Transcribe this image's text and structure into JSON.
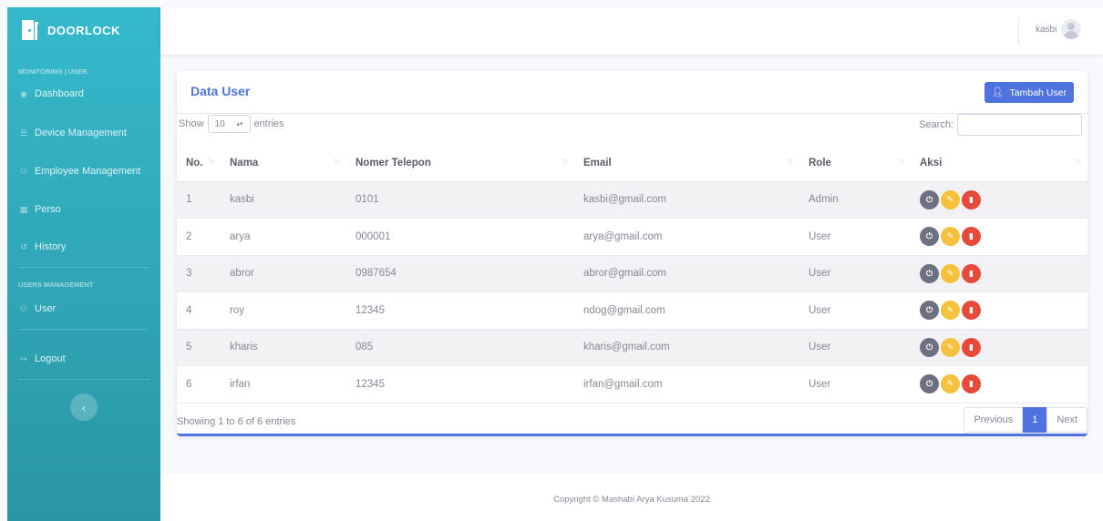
{
  "brand": {
    "name": "DOORLOCK"
  },
  "sidebar": {
    "heading_monitoring": "MONITORING | USER",
    "heading_users": "USERS MANAGEMENT",
    "items": [
      {
        "label": "Dashboard",
        "icon": "dashboard-icon"
      },
      {
        "label": "Device Management",
        "icon": "device-icon"
      },
      {
        "label": "Employee Management",
        "icon": "users-icon"
      },
      {
        "label": "Perso",
        "icon": "building-icon"
      },
      {
        "label": "History",
        "icon": "history-icon"
      },
      {
        "label": "User",
        "icon": "users-icon"
      },
      {
        "label": "Logout",
        "icon": "logout-icon"
      }
    ],
    "toggle": "‹"
  },
  "topbar": {
    "username": "kasbi"
  },
  "card": {
    "title": "Data User",
    "add_button": "Tambah User",
    "show_label": "Show",
    "entries_label": "entries",
    "page_size": "10",
    "search_label": "Search:",
    "search_value": ""
  },
  "table": {
    "columns": [
      "No.",
      "Nama",
      "Nomer Telepon",
      "Email",
      "Role",
      "Aksi"
    ],
    "rows": [
      {
        "no": "1",
        "nama": "kasbi",
        "telepon": "0101",
        "email": "kasbi@gmail.com",
        "role": "Admin"
      },
      {
        "no": "2",
        "nama": "arya",
        "telepon": "000001",
        "email": "arya@gmail.com",
        "role": "User"
      },
      {
        "no": "3",
        "nama": "abror",
        "telepon": "0987654",
        "email": "abror@gmail.com",
        "role": "User"
      },
      {
        "no": "4",
        "nama": "roy",
        "telepon": "12345",
        "email": "ndog@gmail.com",
        "role": "User"
      },
      {
        "no": "5",
        "nama": "kharis",
        "telepon": "085",
        "email": "kharis@gmail.com",
        "role": "User"
      },
      {
        "no": "6",
        "nama": "irfan",
        "telepon": "12345",
        "email": "irfan@gmail.com",
        "role": "User"
      }
    ]
  },
  "pagination": {
    "info": "Showing 1 to 6 of 6 entries",
    "previous": "Previous",
    "current": "1",
    "next": "Next"
  },
  "footer": {
    "copyright": "Copyright © Mashabi Arya Kusuma 2022"
  },
  "colors": {
    "sidebar": "#36b9cc",
    "primary": "#4e73df",
    "warning": "#f6c23e",
    "danger": "#e74a3b",
    "secondary": "#6e7081"
  }
}
